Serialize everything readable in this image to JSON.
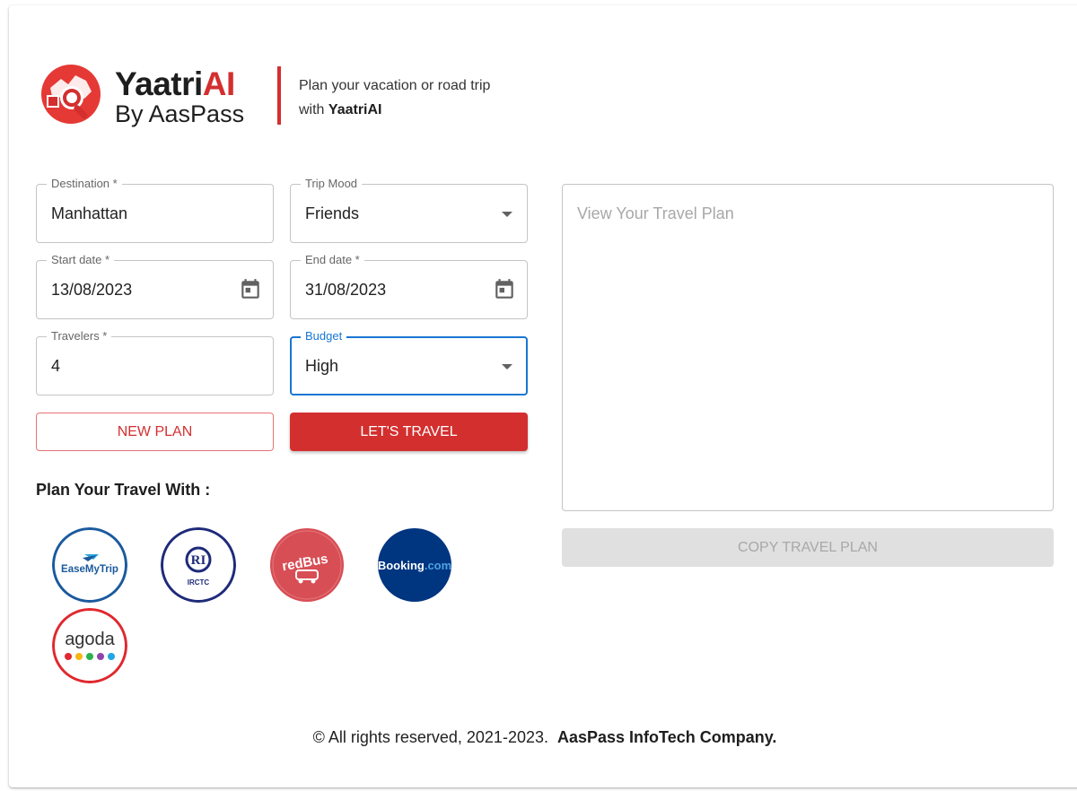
{
  "brand": {
    "name_main": "Yaatri",
    "name_accent": "AI",
    "sub": "By AasPass",
    "tagline_prefix": "Plan your vacation or road trip with ",
    "tagline_bold": "YaatriAI"
  },
  "form": {
    "destination": {
      "label": "Destination *",
      "value": "Manhattan"
    },
    "trip_mood": {
      "label": "Trip Mood",
      "value": "Friends"
    },
    "start_date": {
      "label": "Start date *",
      "value": "13/08/2023"
    },
    "end_date": {
      "label": "End date *",
      "value": "31/08/2023"
    },
    "travelers": {
      "label": "Travelers *",
      "value": "4"
    },
    "budget": {
      "label": "Budget",
      "value": "High"
    }
  },
  "actions": {
    "new_plan": "NEW PLAN",
    "lets_travel": "LET'S TRAVEL",
    "copy_plan": "COPY TRAVEL PLAN"
  },
  "partners": {
    "title": "Plan Your Travel With :",
    "items": [
      {
        "name": "EaseMyTrip",
        "icon": "easemytrip-logo",
        "color": "#1a5a9e"
      },
      {
        "name": "IRCTC",
        "icon": "irctc-logo",
        "color": "#1e2a7a"
      },
      {
        "name": "redBus",
        "icon": "redbus-logo",
        "color": "#d84e55"
      },
      {
        "name": "Booking.com",
        "icon": "booking-logo",
        "color": "#003580"
      },
      {
        "name": "agoda",
        "icon": "agoda-logo",
        "color": "#e0282e"
      }
    ]
  },
  "output": {
    "placeholder": "View Your Travel Plan"
  },
  "footer": {
    "text": "© All rights reserved, 2021-2023.",
    "company": "AasPass InfoTech Company."
  },
  "colors": {
    "accent": "#d32f2f",
    "focus": "#1976d2",
    "disabled_bg": "#e0e0e0"
  }
}
